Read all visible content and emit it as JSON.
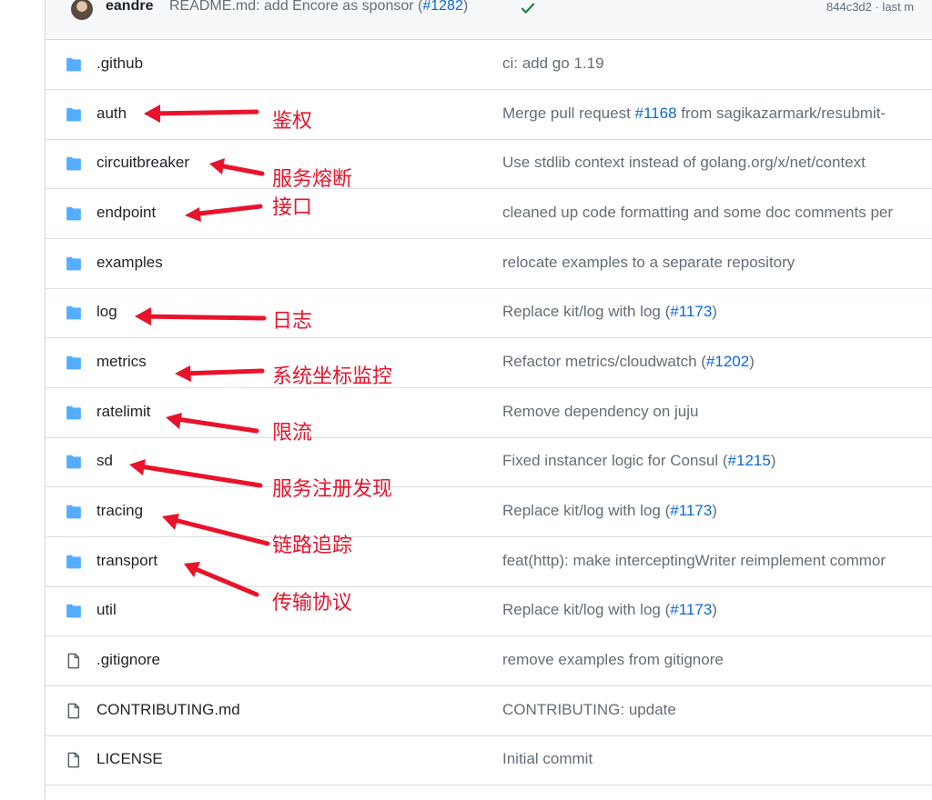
{
  "commit": {
    "user": "eandre",
    "message_prefix": "README.md: add Encore as sponsor (",
    "pr": "#1282",
    "message_suffix": ")",
    "meta": "844c3d2 · last m"
  },
  "files": [
    {
      "type": "folder",
      "name": ".github",
      "msg": "ci: add go 1.19",
      "pr": "",
      "msg_suffix": ""
    },
    {
      "type": "folder",
      "name": "auth",
      "msg": "Merge pull request ",
      "pr": "#1168",
      "msg_suffix": " from sagikazarmark/resubmit-"
    },
    {
      "type": "folder",
      "name": "circuitbreaker",
      "msg": "Use stdlib context instead of golang.org/x/net/context",
      "pr": "",
      "msg_suffix": ""
    },
    {
      "type": "folder",
      "name": "endpoint",
      "msg": "cleaned up code formatting and some doc comments per",
      "pr": "",
      "msg_suffix": ""
    },
    {
      "type": "folder",
      "name": "examples",
      "msg": "relocate examples to a separate repository",
      "pr": "",
      "msg_suffix": ""
    },
    {
      "type": "folder",
      "name": "log",
      "msg": "Replace kit/log with log (",
      "pr": "#1173",
      "msg_suffix": ")"
    },
    {
      "type": "folder",
      "name": "metrics",
      "msg": "Refactor metrics/cloudwatch (",
      "pr": "#1202",
      "msg_suffix": ")"
    },
    {
      "type": "folder",
      "name": "ratelimit",
      "msg": "Remove dependency on juju",
      "pr": "",
      "msg_suffix": ""
    },
    {
      "type": "folder",
      "name": "sd",
      "msg": "Fixed instancer logic for Consul (",
      "pr": "#1215",
      "msg_suffix": ")"
    },
    {
      "type": "folder",
      "name": "tracing",
      "msg": "Replace kit/log with log (",
      "pr": "#1173",
      "msg_suffix": ")"
    },
    {
      "type": "folder",
      "name": "transport",
      "msg": "feat(http): make interceptingWriter reimplement commor",
      "pr": "",
      "msg_suffix": ""
    },
    {
      "type": "folder",
      "name": "util",
      "msg": "Replace kit/log with log (",
      "pr": "#1173",
      "msg_suffix": ")"
    },
    {
      "type": "file",
      "name": ".gitignore",
      "msg": "remove examples from gitignore",
      "pr": "",
      "msg_suffix": ""
    },
    {
      "type": "file",
      "name": "CONTRIBUTING.md",
      "msg": "CONTRIBUTING: update",
      "pr": "",
      "msg_suffix": ""
    },
    {
      "type": "file",
      "name": "LICENSE",
      "msg": "Initial commit",
      "pr": "",
      "msg_suffix": ""
    }
  ],
  "annotations": [
    {
      "target": "auth",
      "text": "鉴权"
    },
    {
      "target": "circuitbreaker",
      "text": "服务熔断"
    },
    {
      "target": "endpoint",
      "text": "接口"
    },
    {
      "target": "log",
      "text": "日志"
    },
    {
      "target": "metrics",
      "text": "系统坐标监控"
    },
    {
      "target": "ratelimit",
      "text": "限流"
    },
    {
      "target": "sd",
      "text": "服务注册发现"
    },
    {
      "target": "tracing",
      "text": "链路追踪"
    },
    {
      "target": "transport",
      "text": "传输协议"
    }
  ],
  "colors": {
    "folder": "#54aeff",
    "link": "#0969da",
    "annotation": "#e8132b",
    "check": "#1a7f37"
  }
}
